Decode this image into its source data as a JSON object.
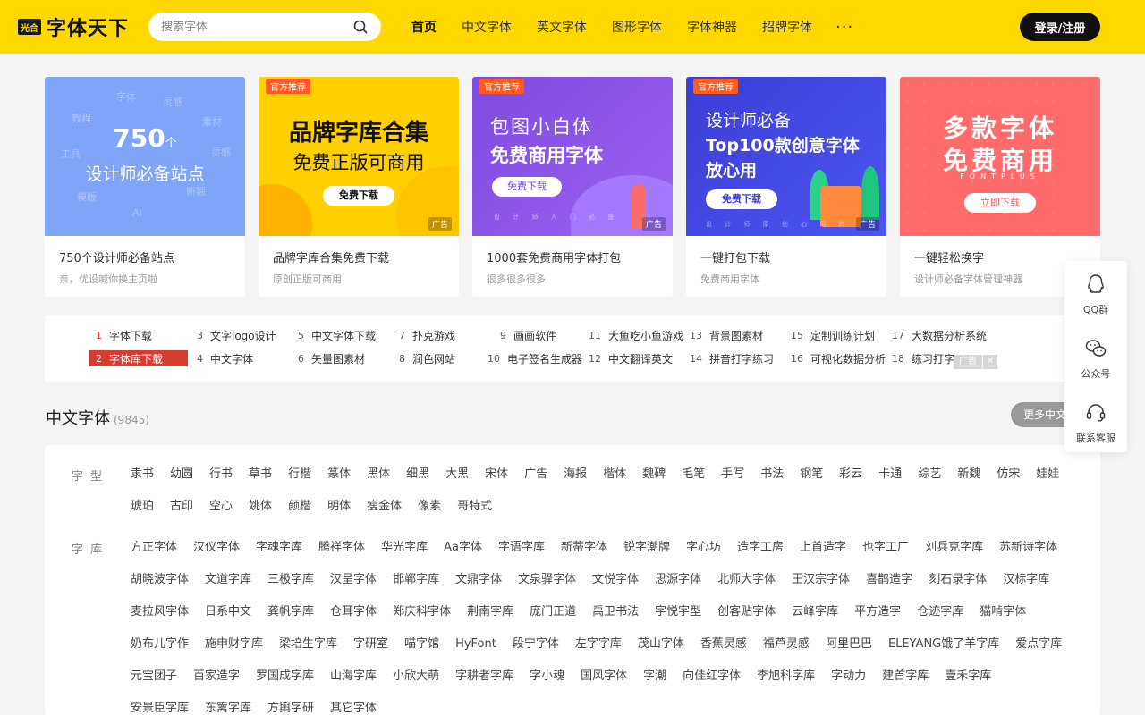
{
  "header": {
    "logo_badge": "光合",
    "logo_text": "字体天下",
    "search_placeholder": "搜索字体",
    "nav": [
      "首页",
      "中文字体",
      "英文字体",
      "图形字体",
      "字体神器",
      "招牌字体"
    ],
    "nav_more": "···",
    "login": "登录/注册"
  },
  "banners": [
    {
      "title": "750个设计师必备站点",
      "subtitle": "亲，优设喊你换主页啦",
      "img_big": "750",
      "img_big_unit": "个",
      "img_line2": "设计师必备站点",
      "ghost_words": [
        "字体",
        "灵感",
        "教程",
        "素材",
        "工具",
        "灵感",
        "模版",
        "新颖",
        "AI"
      ]
    },
    {
      "title": "品牌字库合集免费下载",
      "subtitle": "原创正版可商用",
      "tag": "官方推荐",
      "ad": "广告",
      "img_h1": "品牌字库合集",
      "img_h2": "免费正版可商用",
      "img_btn": "免费下载"
    },
    {
      "title": "1000套免费商用字体打包",
      "subtitle": "很多很多很多",
      "tag": "官方推荐",
      "ad": "广告",
      "img_h1": "包图小白体",
      "img_h2": "免费商用字体",
      "img_btn": "免费下载",
      "img_dots": "设 计 师 入 门 必 备"
    },
    {
      "title": "一键打包下载",
      "subtitle": "免费商用字体",
      "tag": "官方推荐",
      "ad": "广告",
      "img_h1": "设计师必备",
      "img_h2": "Top100款创意字体",
      "img_h3": "放心用",
      "img_btn": "免费下载",
      "img_dots": "设 计 师 原 创 心 用 的"
    },
    {
      "title": "一键轻松换字",
      "subtitle": "设计师必备字体管理神器",
      "img_h1": "多款字体",
      "img_h2": "免费商用",
      "img_h3": "FONTPLUS",
      "img_btn": "立即下载"
    }
  ],
  "hot_links": [
    {
      "num": "1",
      "label": "字体下载"
    },
    {
      "num": "2",
      "label": "字体库下载"
    },
    {
      "num": "3",
      "label": "文字logo设计"
    },
    {
      "num": "4",
      "label": "中文字体"
    },
    {
      "num": "5",
      "label": "中文字体下载"
    },
    {
      "num": "6",
      "label": "矢量图素材"
    },
    {
      "num": "7",
      "label": "扑克游戏"
    },
    {
      "num": "8",
      "label": "润色网站"
    },
    {
      "num": "9",
      "label": "画画软件"
    },
    {
      "num": "10",
      "label": "电子签名生成器"
    },
    {
      "num": "11",
      "label": "大鱼吃小鱼游戏"
    },
    {
      "num": "12",
      "label": "中文翻译英文"
    },
    {
      "num": "13",
      "label": "背景图素材"
    },
    {
      "num": "14",
      "label": "拼音打字练习"
    },
    {
      "num": "15",
      "label": "定制训练计划"
    },
    {
      "num": "16",
      "label": "可视化数据分析"
    },
    {
      "num": "17",
      "label": "大数据分析系统"
    },
    {
      "num": "18",
      "label": "练习打字"
    }
  ],
  "hot_ad": "广告",
  "hot_ad_close": "✕",
  "section": {
    "title": "中文字体",
    "count": "(9845)",
    "more": "更多中文字体"
  },
  "categories": {
    "style_label": "字型",
    "styles": [
      "隶书",
      "幼圆",
      "行书",
      "草书",
      "行楷",
      "篆体",
      "黑体",
      "细黑",
      "大黑",
      "宋体",
      "广告",
      "海报",
      "楷体",
      "魏碑",
      "毛笔",
      "手写",
      "书法",
      "钢笔",
      "彩云",
      "卡通",
      "综艺",
      "新魏",
      "仿宋",
      "娃娃",
      "琥珀",
      "古印",
      "空心",
      "姚体",
      "颜楷",
      "明体",
      "瘦金体",
      "像素",
      "哥特式"
    ],
    "foundry_label": "字库",
    "foundries": [
      "方正字体",
      "汉仪字体",
      "字魂字库",
      "腾祥字体",
      "华光字库",
      "Aa字体",
      "字语字库",
      "新蒂字体",
      "锐字潮牌",
      "字心坊",
      "造字工房",
      "上首造字",
      "也字工厂",
      "刘兵克字库",
      "苏新诗字体",
      "胡晓波字体",
      "文道字库",
      "三极字库",
      "汉呈字体",
      "邯郸字库",
      "文鼎字体",
      "文泉驿字体",
      "文悦字体",
      "思源字体",
      "北师大字体",
      "王汉宗字体",
      "喜鹊造字",
      "刻石录字体",
      "汉标字库",
      "麦拉风字体",
      "日系中文",
      "龚帆字库",
      "仓耳字体",
      "郑庆科字体",
      "荆南字库",
      "庞门正道",
      "禹卫书法",
      "字悦字型",
      "创客贴字体",
      "云峰字库",
      "平方造字",
      "仓迹字库",
      "猫啃字体",
      "奶布儿字作",
      "施申财字库",
      "梁培生字库",
      "字研室",
      "喵字馆",
      "HyFont",
      "段宁字体",
      "左字字库",
      "茂山字体",
      "香蕉灵感",
      "福芦灵感",
      "阿里巴巴",
      "ELEYANG饿了羊字库",
      "爱点字库",
      "元宝团子",
      "百家造字",
      "罗国成字库",
      "山海字库",
      "小欣大萌",
      "字耕者字库",
      "字小魂",
      "国风字体",
      "字潮",
      "向佳红字体",
      "李旭科字库",
      "字动力",
      "建首字库",
      "壹禾字库",
      "安景臣字库",
      "东篱字库",
      "方舆字研",
      "其它字体"
    ]
  },
  "float": {
    "qq": "QQ群",
    "wechat": "公众号",
    "service": "联系客服"
  },
  "colors": {
    "brand_yellow": "#ffd800",
    "hot_active": "#d63c2f",
    "hot_num_red": "#e53935"
  }
}
